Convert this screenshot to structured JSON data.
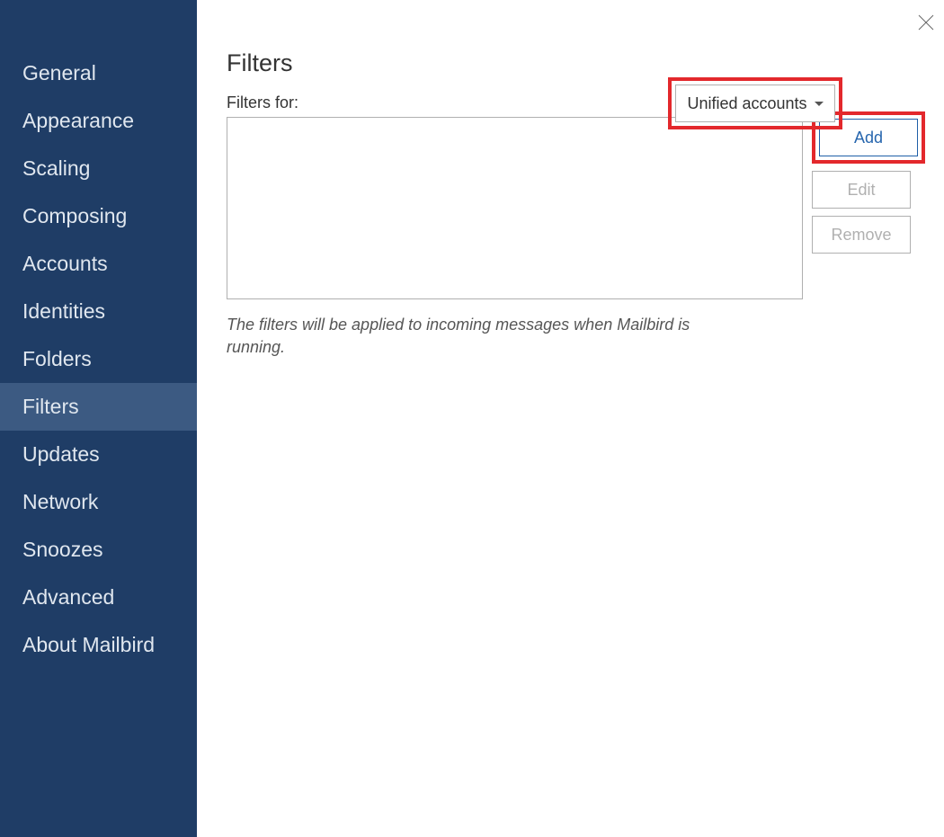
{
  "sidebar": {
    "items": [
      {
        "label": "General"
      },
      {
        "label": "Appearance"
      },
      {
        "label": "Scaling"
      },
      {
        "label": "Composing"
      },
      {
        "label": "Accounts"
      },
      {
        "label": "Identities"
      },
      {
        "label": "Folders"
      },
      {
        "label": "Filters",
        "selected": true
      },
      {
        "label": "Updates"
      },
      {
        "label": "Network"
      },
      {
        "label": "Snoozes"
      },
      {
        "label": "Advanced"
      },
      {
        "label": "About Mailbird"
      }
    ]
  },
  "main": {
    "title": "Filters",
    "filters_for_label": "Filters for:",
    "dropdown_value": "Unified accounts",
    "buttons": {
      "add": "Add",
      "edit": "Edit",
      "remove": "Remove"
    },
    "info_text": "The filters will be applied to incoming messages when Mailbird is running."
  }
}
